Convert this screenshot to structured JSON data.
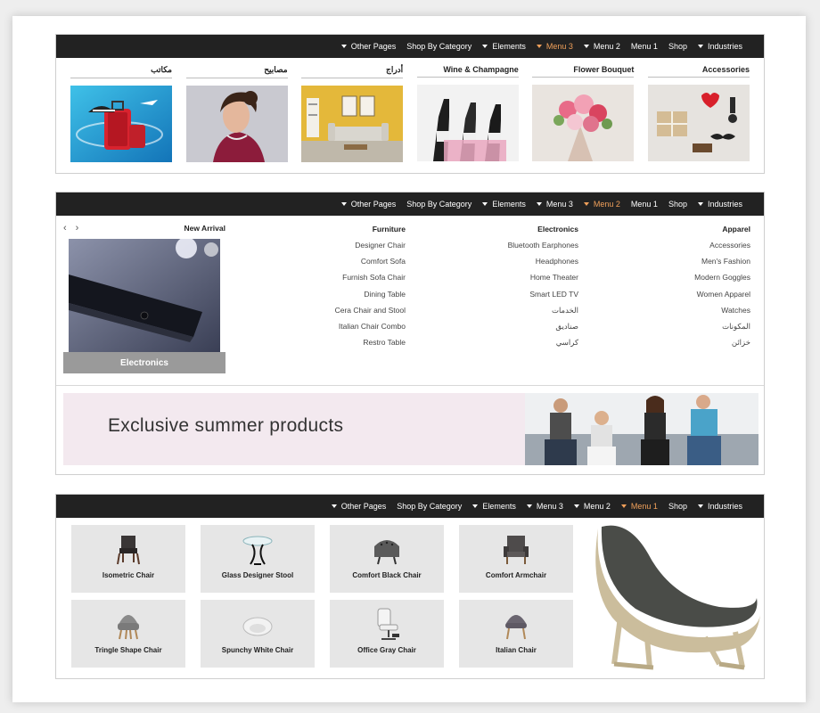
{
  "navs": [
    {
      "items": [
        {
          "label": "Other Pages",
          "caret": true,
          "active": false
        },
        {
          "label": "Shop By Category",
          "caret": false,
          "active": false
        },
        {
          "label": "Elements",
          "caret": true,
          "active": false
        },
        {
          "label": "Menu 3",
          "caret": true,
          "active": true
        },
        {
          "label": "Menu 2",
          "caret": true,
          "active": false
        },
        {
          "label": "Menu 1",
          "caret": false,
          "active": false
        },
        {
          "label": "Shop",
          "caret": false,
          "active": false
        },
        {
          "label": "Industries",
          "caret": true,
          "active": false
        }
      ]
    },
    {
      "items": [
        {
          "label": "Other Pages",
          "caret": true,
          "active": false
        },
        {
          "label": "Shop By Category",
          "caret": false,
          "active": false
        },
        {
          "label": "Elements",
          "caret": true,
          "active": false
        },
        {
          "label": "Menu 3",
          "caret": true,
          "active": false
        },
        {
          "label": "Menu 2",
          "caret": true,
          "active": true
        },
        {
          "label": "Menu 1",
          "caret": false,
          "active": false
        },
        {
          "label": "Shop",
          "caret": false,
          "active": false
        },
        {
          "label": "Industries",
          "caret": true,
          "active": false
        }
      ]
    },
    {
      "items": [
        {
          "label": "Other Pages",
          "caret": true,
          "active": false
        },
        {
          "label": "Shop By Category",
          "caret": false,
          "active": false
        },
        {
          "label": "Elements",
          "caret": true,
          "active": false
        },
        {
          "label": "Menu 3",
          "caret": true,
          "active": false
        },
        {
          "label": "Menu 2",
          "caret": true,
          "active": false
        },
        {
          "label": "Menu 1",
          "caret": true,
          "active": true
        },
        {
          "label": "Shop",
          "caret": false,
          "active": false
        },
        {
          "label": "Industries",
          "caret": true,
          "active": false
        }
      ]
    }
  ],
  "menu3": {
    "categories": [
      {
        "title": "مكاتب",
        "image": "luggage"
      },
      {
        "title": "مصابيح",
        "image": "woman-portrait"
      },
      {
        "title": "أدراج",
        "image": "living-room"
      },
      {
        "title": "Wine & Champagne",
        "image": "champagne"
      },
      {
        "title": "Flower Bouquet",
        "image": "flowers"
      },
      {
        "title": "Accessories",
        "image": "accessories"
      }
    ]
  },
  "menu2": {
    "new_arrival": {
      "title": "New Arrival",
      "caption": "Electronics",
      "prev_icon": "chevron-left-icon",
      "next_icon": "chevron-right-icon"
    },
    "columns": [
      {
        "title": "Furniture",
        "links": [
          "Designer Chair",
          "Comfort Sofa",
          "Furnish Sofa Chair",
          "Dining Table",
          "Cera Chair and Stool",
          "Italian Chair Combo",
          "Restro Table"
        ]
      },
      {
        "title": "Electronics",
        "links": [
          "Bluetooth Earphones",
          "Headphones",
          "Home Theater",
          "Smart LED TV",
          "الخدمات",
          "صناديق",
          "كراسي"
        ]
      },
      {
        "title": "Apparel",
        "links": [
          "Accessories",
          "Men's Fashion",
          "Modern Goggles",
          "Women Apparel",
          "Watches",
          "المكونات",
          "خزائن"
        ]
      }
    ],
    "banner": {
      "text": "Exclusive summer products"
    }
  },
  "menu1": {
    "products": [
      {
        "label": "Isometric Chair",
        "icon": "isometric-chair-icon"
      },
      {
        "label": "Glass Designer Stool",
        "icon": "glass-stool-icon"
      },
      {
        "label": "Comfort Black Chair",
        "icon": "black-chair-icon"
      },
      {
        "label": "Comfort Armchair",
        "icon": "armchair-icon"
      },
      {
        "label": "Tringle Shape Chair",
        "icon": "tringle-chair-icon"
      },
      {
        "label": "Spunchy White Chair",
        "icon": "white-chair-icon"
      },
      {
        "label": "Office Gray Chair",
        "icon": "office-chair-icon"
      },
      {
        "label": "Italian Chair",
        "icon": "italian-chair-icon"
      }
    ],
    "feature_image": "lounge-chair"
  },
  "colors": {
    "nav_bg": "#222222",
    "active": "#f0a05a",
    "tile_bg": "#e6e6e6",
    "caption_bg": "#9a9a9a",
    "banner_bg": "#f3e9ef"
  }
}
